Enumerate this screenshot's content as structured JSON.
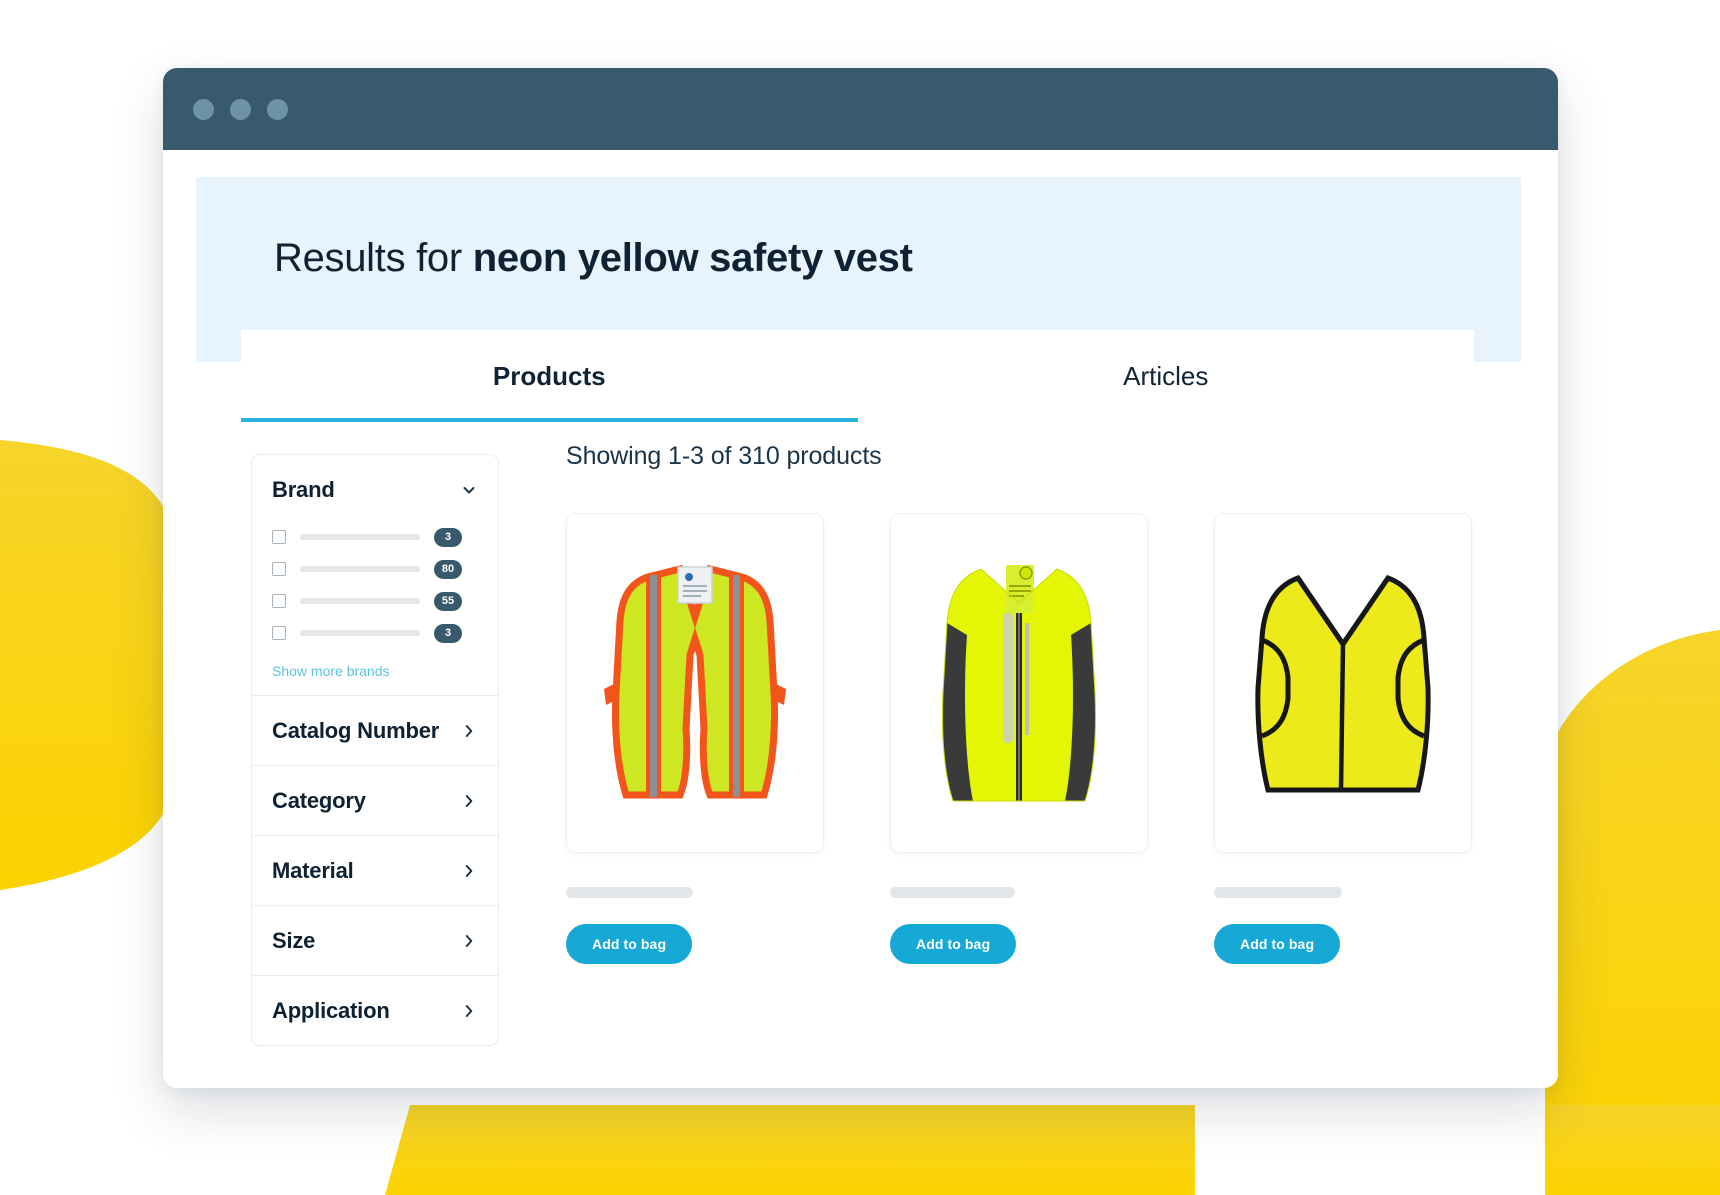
{
  "window": {
    "traffic_lights": [
      "dot-red",
      "dot-yellow",
      "dot-green"
    ]
  },
  "banner": {
    "prefix": "Results for ",
    "query": "neon yellow safety vest"
  },
  "tabs": [
    {
      "label": "Products",
      "active": true
    },
    {
      "label": "Articles",
      "active": false
    }
  ],
  "sidebar": {
    "brand": {
      "title": "Brand",
      "chevron": "chevron-down-icon",
      "options": [
        {
          "count": "3"
        },
        {
          "count": "80"
        },
        {
          "count": "55"
        },
        {
          "count": "3"
        }
      ],
      "show_more_label": "Show more brands"
    },
    "filters": [
      {
        "label": "Catalog Number",
        "chevron": "chevron-right-icon"
      },
      {
        "label": "Category",
        "chevron": "chevron-right-icon"
      },
      {
        "label": "Material",
        "chevron": "chevron-right-icon"
      },
      {
        "label": "Size",
        "chevron": "chevron-right-icon"
      },
      {
        "label": "Application",
        "chevron": "chevron-right-icon"
      }
    ]
  },
  "results": {
    "showing_text": "Showing 1-3 of 310 products",
    "products": [
      {
        "image_alt": "mesh-safety-vest-orange-trim",
        "add_label": "Add to bag"
      },
      {
        "image_alt": "neon-yellow-zip-vest-black-panels",
        "add_label": "Add to bag"
      },
      {
        "image_alt": "yellow-vest-black-binding",
        "add_label": "Add to bag"
      }
    ]
  },
  "colors": {
    "titlebar": "#39596c",
    "banner_bg": "#e8f4fd",
    "accent_tab_underline": "#29b2dd",
    "button_bg": "#17a9d6",
    "badge_bg": "#39596c",
    "link": "#5bc2e0",
    "decor_yellow": "#f7d117",
    "text_dark": "#0e2233"
  }
}
